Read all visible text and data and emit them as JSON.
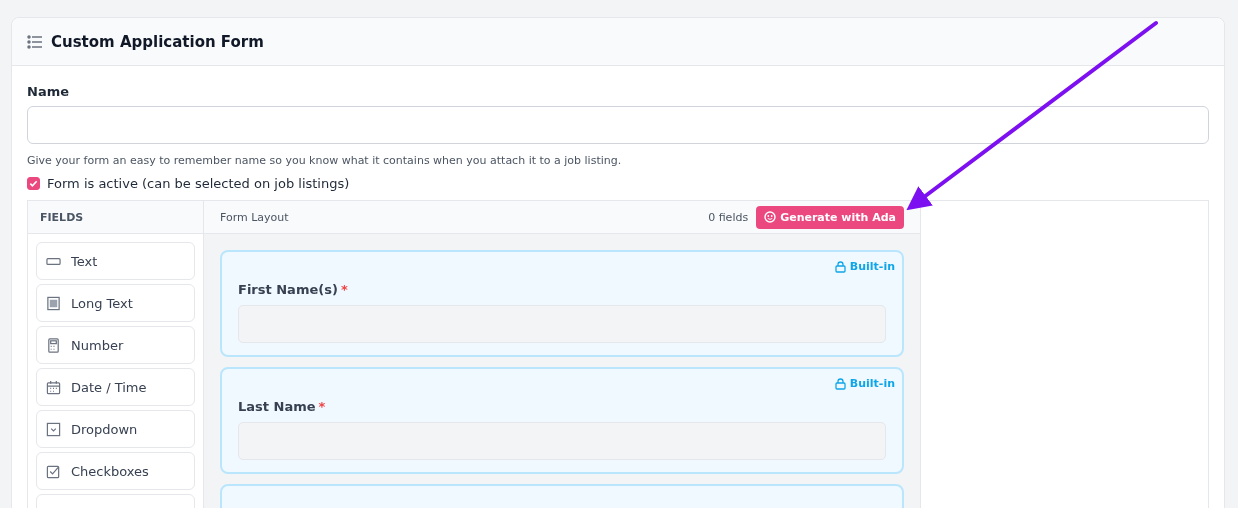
{
  "card": {
    "title": "Custom Application Form"
  },
  "name_field": {
    "label": "Name",
    "help": "Give your form an easy to remember name so you know what it contains when you attach it to a job listing."
  },
  "active_checkbox": {
    "label": "Form is active (can be selected on job listings)",
    "checked": true
  },
  "fields_panel": {
    "heading": "FIELDS",
    "items": [
      {
        "kind": "text",
        "label": "Text"
      },
      {
        "kind": "textarea",
        "label": "Long Text"
      },
      {
        "kind": "number",
        "label": "Number"
      },
      {
        "kind": "datetime",
        "label": "Date / Time"
      },
      {
        "kind": "dropdown",
        "label": "Dropdown"
      },
      {
        "kind": "checkboxes",
        "label": "Checkboxes"
      }
    ]
  },
  "layout_panel": {
    "title": "Form Layout",
    "count": "0 fields",
    "generate_button": "Generate with Ada",
    "fields": [
      {
        "label": "First Name(s)",
        "required_mark": "*",
        "badge": "Built-in"
      },
      {
        "label": "Last Name",
        "required_mark": "*",
        "badge": "Built-in"
      }
    ]
  }
}
